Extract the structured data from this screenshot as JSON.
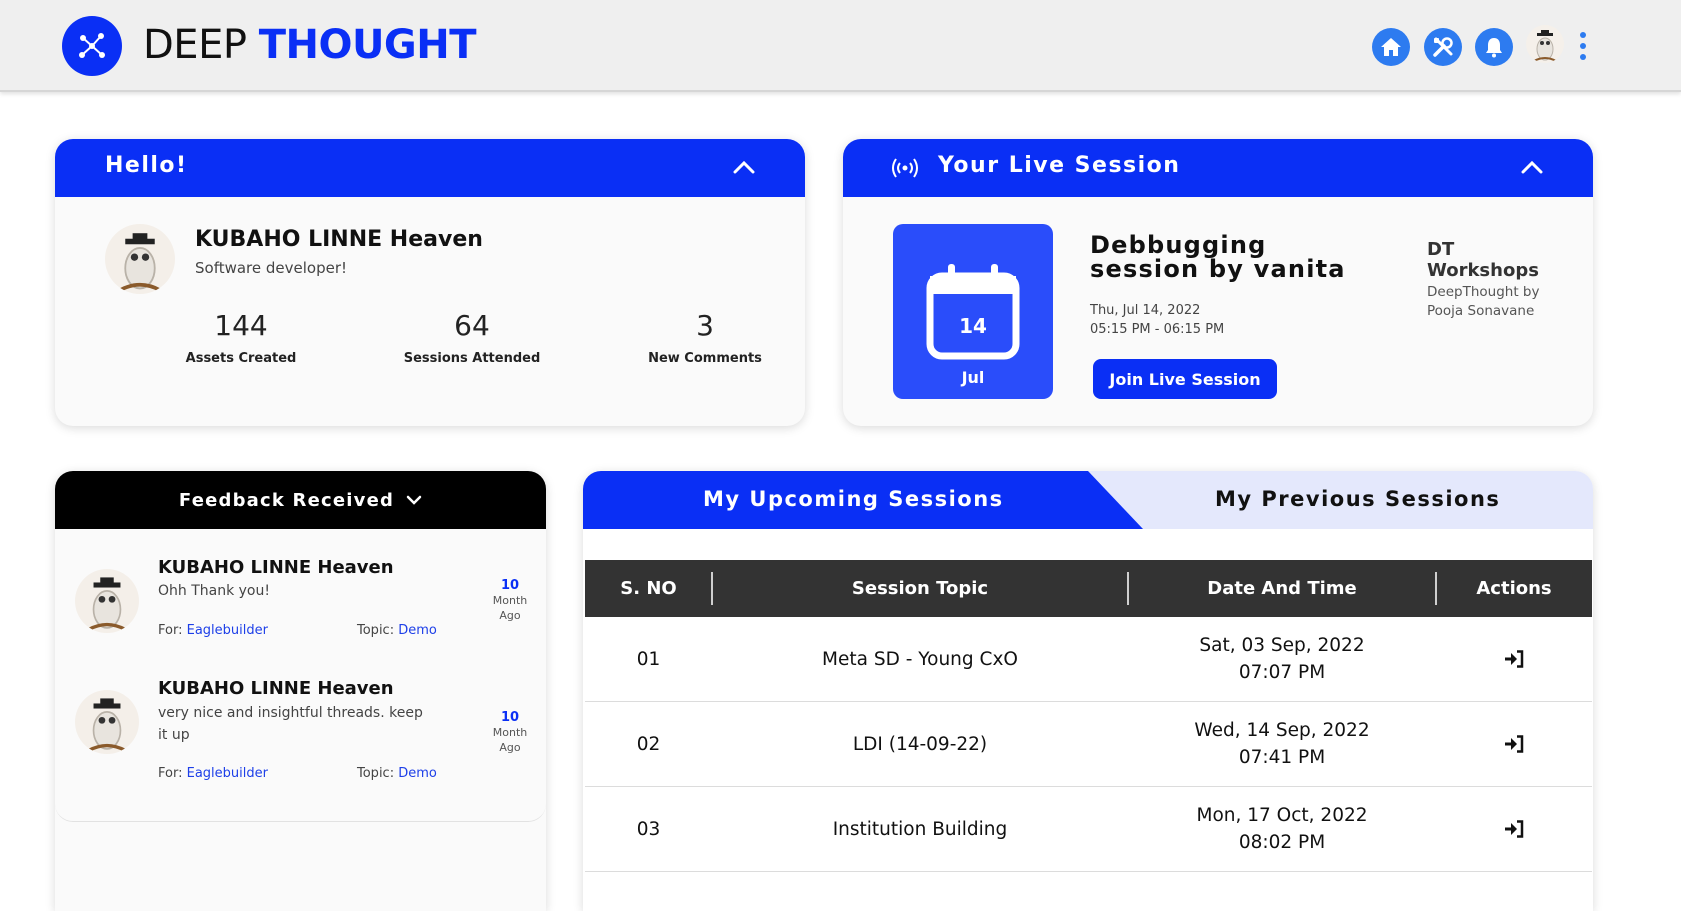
{
  "header": {
    "brand_part1": "DEEP",
    "brand_part2": "THOUGHT",
    "nav_icons": [
      "home-icon",
      "tools-icon",
      "bell-icon"
    ],
    "accent": "#0a2ff5",
    "icon_bg": "#2d7bf0"
  },
  "hello_card": {
    "title": "Hello!",
    "user_name": "KUBAHO LINNE Heaven",
    "user_role": "Software developer!",
    "stats": [
      {
        "value": "144",
        "label": "Assets Created"
      },
      {
        "value": "64",
        "label": "Sessions Attended"
      },
      {
        "value": "3",
        "label": "New Comments"
      }
    ]
  },
  "live_session": {
    "title": "Your Live Session",
    "calendar_day": "14",
    "calendar_month": "Jul",
    "session_title": "Debbugging session by vanita",
    "date": "Thu, Jul 14, 2022",
    "time": "05:15 PM - 06:15 PM",
    "join_label": "Join Live Session",
    "workshop_title": "DT Workshops",
    "workshop_sub": "DeepThought by Pooja Sonavane"
  },
  "feedback": {
    "title": "Feedback Received",
    "items": [
      {
        "name": "KUBAHO LINNE Heaven",
        "text": "Ohh Thank you!",
        "age_num": "10",
        "age_unit": "Month",
        "age_suffix": "Ago",
        "for_label": "For:",
        "for_value": "Eaglebuilder",
        "topic_label": "Topic:",
        "topic_value": "Demo"
      },
      {
        "name": "KUBAHO LINNE Heaven",
        "text": "very nice and insightful threads. keep it up",
        "age_num": "10",
        "age_unit": "Month",
        "age_suffix": "Ago",
        "for_label": "For:",
        "for_value": "Eaglebuilder",
        "topic_label": "Topic:",
        "topic_value": "Demo"
      }
    ]
  },
  "sessions": {
    "tab_upcoming": "My Upcoming Sessions",
    "tab_previous": "My Previous Sessions",
    "columns": [
      "S. NO",
      "Session Topic",
      "Date And Time",
      "Actions"
    ],
    "rows": [
      {
        "sno": "01",
        "topic": "Meta SD - Young CxO",
        "date": "Sat, 03 Sep, 2022",
        "time": "07:07 PM"
      },
      {
        "sno": "02",
        "topic": "LDI (14-09-22)",
        "date": "Wed, 14 Sep, 2022",
        "time": "07:41 PM"
      },
      {
        "sno": "03",
        "topic": "Institution Building",
        "date": "Mon, 17 Oct, 2022",
        "time": "08:02 PM"
      }
    ]
  }
}
